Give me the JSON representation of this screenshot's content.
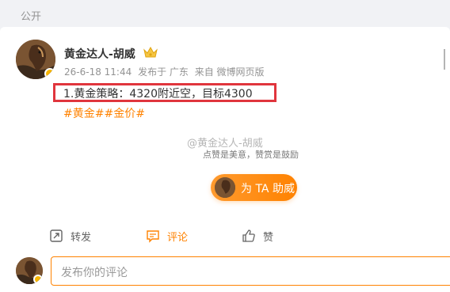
{
  "top": {
    "visibility_label": "公开"
  },
  "post": {
    "username": "黄金达人-胡威",
    "crown_icon": "crown-icon",
    "meta": {
      "date": "26-6-18 11:44",
      "location": "发布于 广东",
      "source": "来自 微博网页版"
    },
    "content": "1.黄金策略：4320附近空，目标4300",
    "tags": [
      "#黄金#",
      "#金价#"
    ],
    "watermark": "@黄金达人-胡威",
    "reward_hint": "点赞是美意，赞赏是鼓励",
    "reward_button": "为 TA 助威"
  },
  "actions": {
    "repost": "转发",
    "comment": "评论",
    "like": "赞"
  },
  "comment_box": {
    "placeholder": "发布你的评论"
  },
  "colors": {
    "accent": "#ff8200",
    "highlight_border": "#e0353d",
    "badge": "#f7b500"
  }
}
